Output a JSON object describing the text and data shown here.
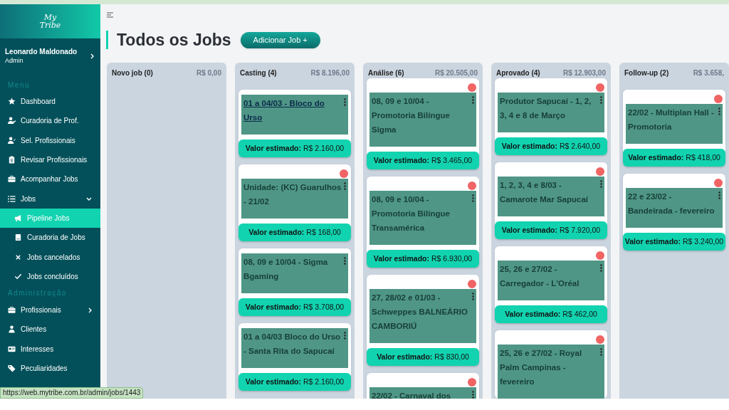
{
  "sidebar": {
    "logo": "My Tribe",
    "user": {
      "name": "Leonardo Maldonado",
      "role": "Admin"
    },
    "sections": [
      {
        "heading": "Menu",
        "items": [
          {
            "label": "Dashboard",
            "selected": false
          },
          {
            "label": "Curadoria de Prof.",
            "selected": false
          },
          {
            "label": "Sel. Profissionais",
            "selected": false
          },
          {
            "label": "Revisar Profissionais",
            "selected": false
          },
          {
            "label": "Acompanhar Jobs",
            "selected": false
          },
          {
            "label": "Jobs",
            "selected": false,
            "expanded": true,
            "children": [
              {
                "label": "Pipeline Jobs",
                "selected": true
              },
              {
                "label": "Curadoria de Jobs",
                "selected": false
              },
              {
                "label": "Jobs cancelados",
                "selected": false
              },
              {
                "label": "Jobs concluídos",
                "selected": false
              }
            ]
          }
        ]
      },
      {
        "heading": "Administração",
        "items": [
          {
            "label": "Profissionais",
            "selected": false,
            "expanded": false
          },
          {
            "label": "Clientes",
            "selected": false
          },
          {
            "label": "Interesses",
            "selected": false
          },
          {
            "label": "Peculiaridades",
            "selected": false
          }
        ]
      }
    ]
  },
  "page": {
    "title": "Todos os Jobs",
    "add_button": "Adicionar Job +"
  },
  "columns": [
    {
      "title": "Novo job (0)",
      "total": "R$ 0,00"
    },
    {
      "title": "Casting (4)",
      "total": "R$ 8.196,00",
      "cards": [
        {
          "title": "01 a 04/03 - Bloco do Urso",
          "link": true,
          "alert": false,
          "value_label": "Valor estimado:",
          "value": "R$ 2.160,00"
        },
        {
          "title": "Unidade: (KC) Guarulhos - 21/02",
          "link": false,
          "alert": true,
          "value_label": "Valor estimado:",
          "value": "R$ 168,00"
        },
        {
          "title": "08, 09 e 10/04 - Sigma Bgaming",
          "link": false,
          "alert": false,
          "value_label": "Valor estimado:",
          "value": "R$ 3.708,00"
        },
        {
          "title": "01 a 04/03 Bloco do Urso - Santa Rita do Sapucaí",
          "link": false,
          "alert": false,
          "value_label": "Valor estimado:",
          "value": "R$ 2.160,00"
        }
      ]
    },
    {
      "title": "Análise (6)",
      "total": "R$ 20.505,00",
      "cards": [
        {
          "title": "08, 09 e 10/04 - Promotoria Bilíngue Sigma",
          "link": false,
          "alert": true,
          "value_label": "Valor estimado:",
          "value": "R$ 3.465,00"
        },
        {
          "title": "08, 09 e 10/04 - Promotoria Bilíngue Transamérica",
          "link": false,
          "alert": true,
          "value_label": "Valor estimado:",
          "value": "R$ 6.930,00"
        },
        {
          "title": "27, 28/02 e 01/03 - Schweppes BALNEÁRIO CAMBORIÚ",
          "link": false,
          "alert": true,
          "value_label": "Valor estimado:",
          "value": "R$ 830,00"
        },
        {
          "title": "22/02 - Carnaval dos",
          "link": false,
          "alert": true
        }
      ]
    },
    {
      "title": "Aprovado (4)",
      "total": "R$ 12.903,00",
      "cards": [
        {
          "title": "Produtor Sapucaí - 1, 2, 3, 4 e 8 de Março",
          "link": false,
          "alert": true,
          "value_label": "Valor estimado:",
          "value": "R$ 2.640,00"
        },
        {
          "title": "1, 2, 3, 4 e 8/03 - Camarote Mar Sapucaí",
          "link": false,
          "alert": true,
          "value_label": "Valor estimado:",
          "value": "R$ 7.920,00"
        },
        {
          "title": "25, 26 e 27/02 - Carregador - L'Oréal",
          "link": false,
          "alert": true,
          "value_label": "Valor estimado:",
          "value": "R$ 462,00"
        },
        {
          "title": "25, 26 e 27/02 - Royal Palm Campinas - fevereiro",
          "link": false,
          "alert": true
        }
      ]
    },
    {
      "title": "Follow-up (2)",
      "total": "R$ 3.658,",
      "cards": [
        {
          "title": "22/02 - Multiplan Hall - Promotoria",
          "link": false,
          "alert": true,
          "value_label": "Valor estimado:",
          "value": "R$ 418,00"
        },
        {
          "title": "22 e 23/02 - Bandeirada - fevereiro",
          "link": false,
          "alert": true,
          "value_label": "Valor estimado:",
          "value": "R$ 3.240,00"
        }
      ]
    }
  ],
  "status_link": "https://web.mytribe.com.br/admin/jobs/1443"
}
